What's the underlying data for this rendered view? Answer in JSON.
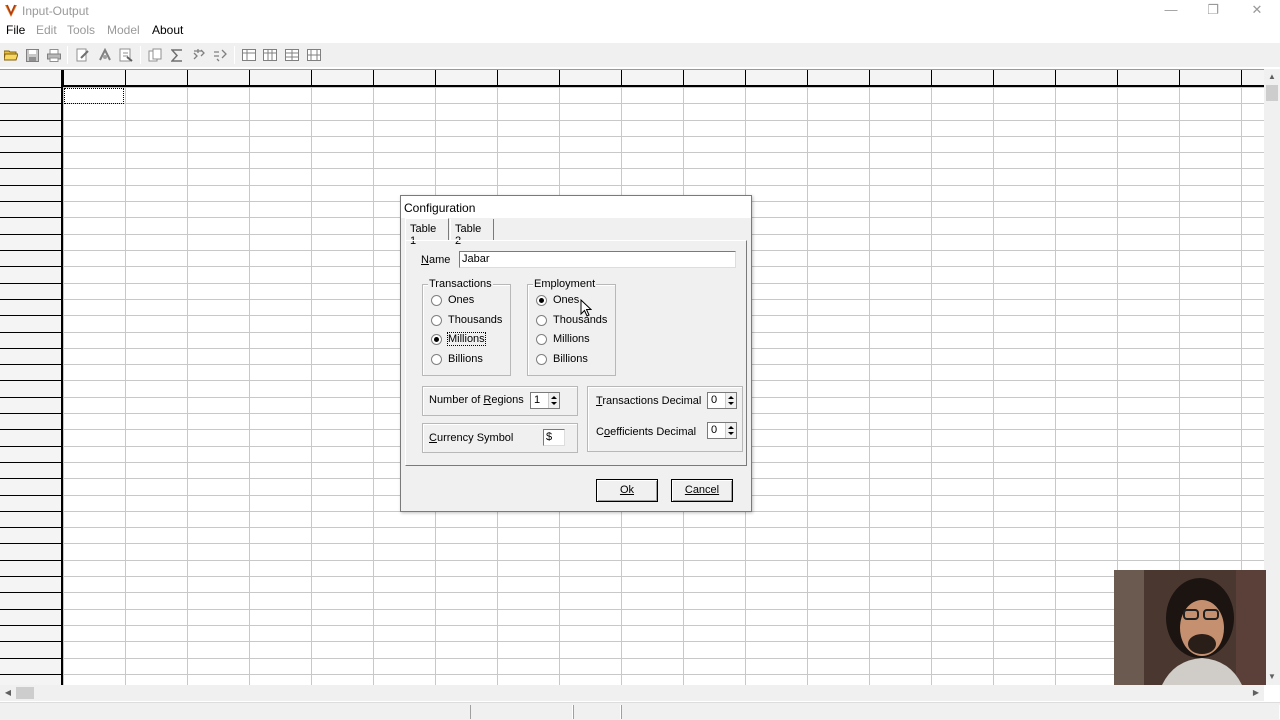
{
  "window": {
    "title": "Input-Output",
    "minimize": "—",
    "restore": "❐",
    "close": "✕"
  },
  "menu": [
    "File",
    "Edit",
    "Tools",
    "Model",
    "About"
  ],
  "toolbar_icons": [
    "open-folder-icon",
    "save-icon",
    "print-icon",
    "edit-table-icon",
    "compute-icon",
    "export-icon",
    "copy-icon",
    "sum-icon",
    "multiplier-icon",
    "impact-icon",
    "table-view-1-icon",
    "table-view-2-icon",
    "table-view-3-icon",
    "table-view-4-icon"
  ],
  "dialog": {
    "title": "Configuration",
    "tabs": [
      "Table 1",
      "Table 2"
    ],
    "active_tab": "Table 1",
    "name_label": "Name",
    "name_value": "Jabar",
    "transactions": {
      "legend": "Transactions",
      "options": [
        "Ones",
        "Thousands",
        "Millions",
        "Billions"
      ],
      "selected": "Millions"
    },
    "employment": {
      "legend": "Employment",
      "options": [
        "Ones",
        "Thousands",
        "Millions",
        "Billions"
      ],
      "selected": "Ones"
    },
    "regions_label": "Number of Regions",
    "regions_value": "1",
    "currency_label": "Currency Symbol",
    "currency_value": "$",
    "trans_decimal_label": "Transactions Decimal",
    "trans_decimal_value": "0",
    "coef_decimal_label": "Coefficients Decimal",
    "coef_decimal_value": "0",
    "ok_label": "Ok",
    "cancel_label": "Cancel"
  },
  "colors": {
    "grid_line": "#c8c8c8",
    "header_bg": "#f4f4f4",
    "dialog_bg": "#f0f0f0"
  }
}
